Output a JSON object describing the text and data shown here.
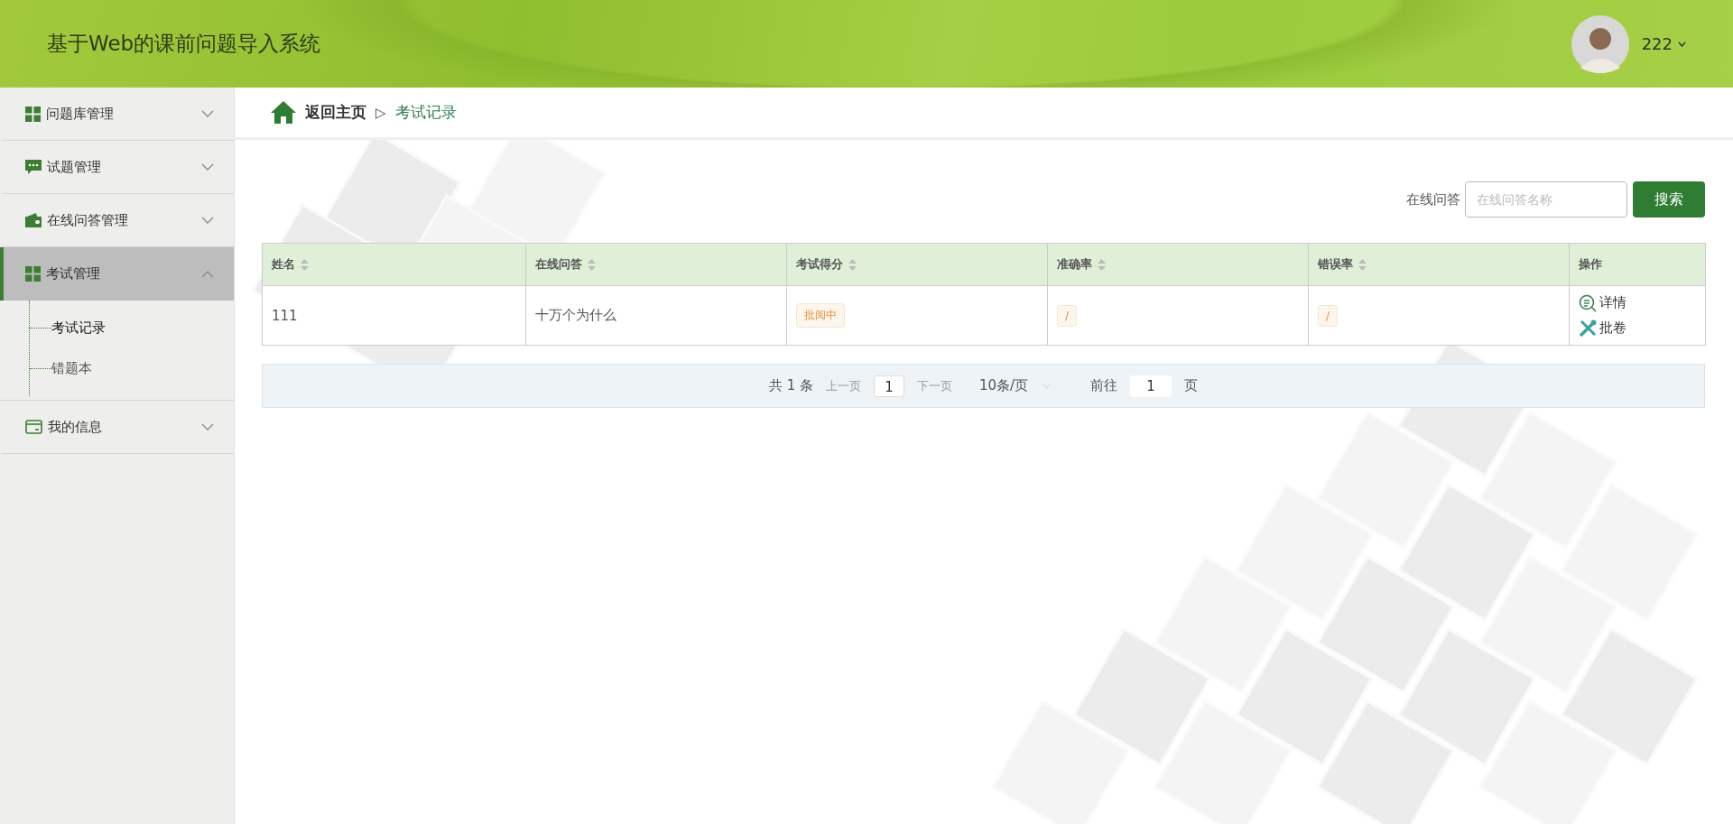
{
  "header": {
    "title": "基于Web的课前问题导入系统",
    "user": "222"
  },
  "sidebar": {
    "items": [
      {
        "label": "问题库管理",
        "expanded": false,
        "selected": false
      },
      {
        "label": "试题管理",
        "expanded": false,
        "selected": false
      },
      {
        "label": "在线问答管理",
        "expanded": false,
        "selected": false
      },
      {
        "label": "考试管理",
        "expanded": true,
        "selected": true,
        "children": [
          {
            "label": "考试记录",
            "selected": true
          },
          {
            "label": "错题本",
            "selected": false
          }
        ]
      },
      {
        "label": "我的信息",
        "expanded": false,
        "selected": false
      }
    ]
  },
  "breadcrumb": {
    "home": "返回主页",
    "separator": "▷",
    "current": "考试记录"
  },
  "search": {
    "label": "在线问答",
    "placeholder": "在线问答名称",
    "button": "搜索"
  },
  "table": {
    "columns": [
      {
        "label": "姓名",
        "sortable": true
      },
      {
        "label": "在线问答",
        "sortable": true
      },
      {
        "label": "考试得分",
        "sortable": true
      },
      {
        "label": "准确率",
        "sortable": true
      },
      {
        "label": "错误率",
        "sortable": true
      },
      {
        "label": "操作",
        "sortable": false
      }
    ],
    "rows": [
      {
        "cells": [
          {
            "kind": "text",
            "text": "111"
          },
          {
            "kind": "text",
            "text": "十万个为什么"
          },
          {
            "kind": "tag",
            "text": "批阅中"
          },
          {
            "kind": "tag",
            "text": "/"
          },
          {
            "kind": "tag",
            "text": "/"
          },
          {
            "kind": "actions",
            "actions": [
              {
                "label": "详情"
              },
              {
                "label": "批卷"
              }
            ]
          }
        ]
      }
    ]
  },
  "pagination": {
    "total": "共 1 条",
    "prev": "上一页",
    "page": "1",
    "next": "下一页",
    "page_size": "10条/页",
    "goto": "前往",
    "goto_value": "1",
    "goto_suffix": "页"
  }
}
